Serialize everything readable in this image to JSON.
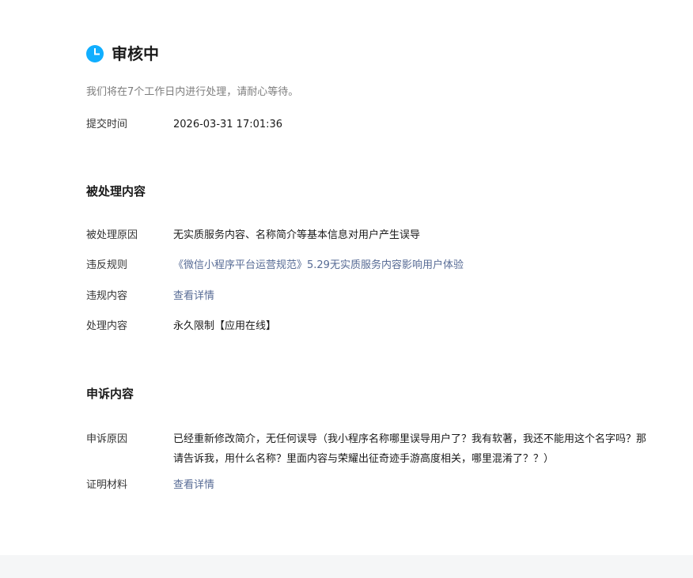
{
  "status": {
    "icon": "clock-icon",
    "title": "审核中",
    "description": "我们将在7个工作日内进行处理，请耐心等待。",
    "submit_label": "提交时间",
    "submit_time": "2026-03-31 17:01:36",
    "accent_color": "#10aeff"
  },
  "processed": {
    "section_title": "被处理内容",
    "rows": [
      {
        "label": "被处理原因",
        "value": "无实质服务内容、名称简介等基本信息对用户产生误导"
      },
      {
        "label": "违反规则",
        "value": "《微信小程序平台运营规范》5.29无实质服务内容影响用户体验"
      },
      {
        "label": "违规内容",
        "value": "查看详情"
      },
      {
        "label": "处理内容",
        "value": "永久限制【应用在线】"
      }
    ]
  },
  "appeal": {
    "section_title": "申诉内容",
    "rows": [
      {
        "label": "申诉原因",
        "value": "已经重新修改简介，无任何误导（我小程序名称哪里误导用户了？我有软著，我还不能用这个名字吗？那请告诉我，用什么名称？里面内容与荣耀出征奇迹手游高度相关，哪里混淆了？？）"
      },
      {
        "label": "证明材料",
        "value": "查看详情"
      }
    ]
  },
  "link_color": "#576b95"
}
